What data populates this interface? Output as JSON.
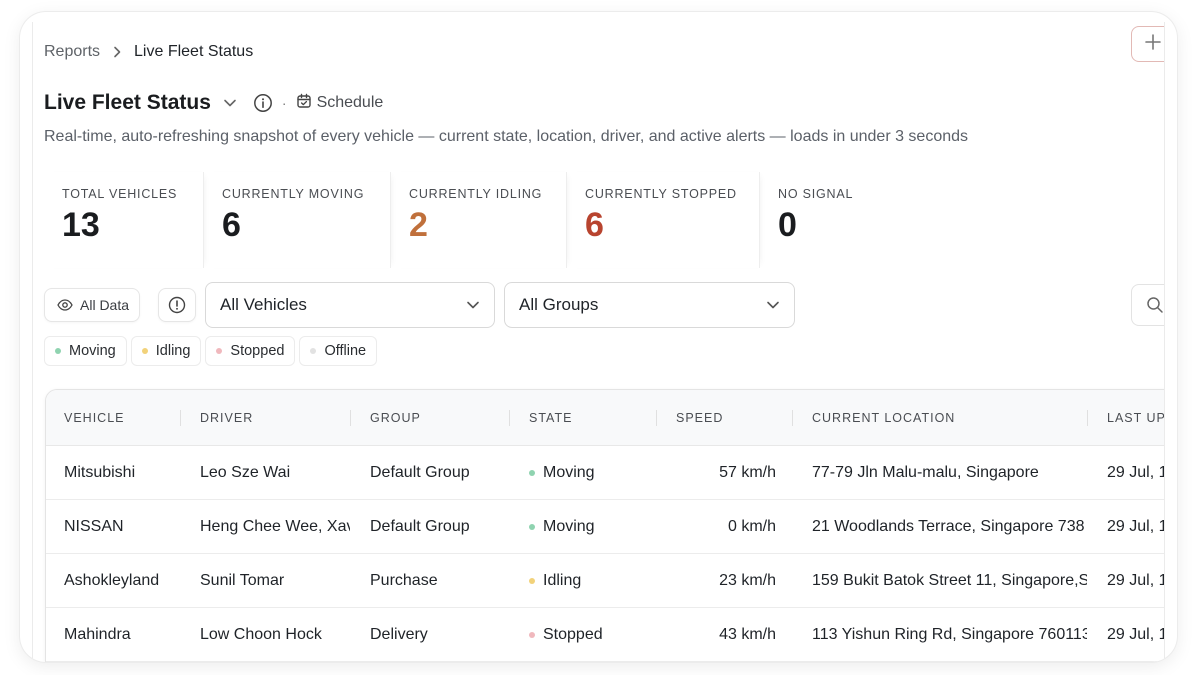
{
  "breadcrumb": {
    "parent": "Reports",
    "current": "Live Fleet Status"
  },
  "header": {
    "title": "Live Fleet Status",
    "schedule_label": "Schedule",
    "subtitle": "Real-time, auto-refreshing snapshot of every vehicle — current state, location, driver, and active alerts — loads in under 3 seconds"
  },
  "stats": [
    {
      "label": "TOTAL VEHICLES",
      "value": "13",
      "color": "#1a1c1f"
    },
    {
      "label": "CURRENTLY MOVING",
      "value": "6",
      "color": "#1a1c1f"
    },
    {
      "label": "CURRENTLY IDLING",
      "value": "2",
      "color": "#c0703b"
    },
    {
      "label": "CURRENTLY STOPPED",
      "value": "6",
      "color": "#b8442f"
    },
    {
      "label": "NO SIGNAL",
      "value": "0",
      "color": "#1a1c1f"
    }
  ],
  "filters": {
    "all_data_label": "All Data",
    "vehicles_select": "All Vehicles",
    "groups_select": "All Groups"
  },
  "legend": [
    {
      "label": "Moving",
      "color": "#8fd3b0"
    },
    {
      "label": "Idling",
      "color": "#f2d27a"
    },
    {
      "label": "Stopped",
      "color": "#f0b8bd"
    },
    {
      "label": "Offline",
      "color": "#e2e2e2"
    }
  ],
  "table": {
    "columns": [
      "VEHICLE",
      "DRIVER",
      "GROUP",
      "STATE",
      "SPEED",
      "CURRENT LOCATION",
      "LAST UP"
    ],
    "rows": [
      {
        "vehicle": "Mitsubishi",
        "driver": "Leo Sze Wai",
        "group": "Default Group",
        "state": "Moving",
        "state_color": "#8fd3b0",
        "speed": "57 km/h",
        "location": "77-79 Jln Malu-malu, Singapore",
        "last_update": "29 Jul, 1"
      },
      {
        "vehicle": "NISSAN",
        "driver": "Heng Chee Wee, Xav",
        "group": "Default Group",
        "state": "Moving",
        "state_color": "#8fd3b0",
        "speed": "0 km/h",
        "location": "21 Woodlands Terrace, Singapore 738",
        "last_update": "29 Jul, 1"
      },
      {
        "vehicle": "Ashokleyland",
        "driver": "Sunil Tomar",
        "group": "Purchase",
        "state": "Idling",
        "state_color": "#f2d27a",
        "speed": "23 km/h",
        "location": "159 Bukit Batok Street 11, Singapore,S",
        "last_update": "29 Jul, 1"
      },
      {
        "vehicle": "Mahindra",
        "driver": "Low Choon Hock",
        "group": "Delivery",
        "state": "Stopped",
        "state_color": "#f0b8bd",
        "speed": "43 km/h",
        "location": "113 Yishun Ring Rd, Singapore 760113",
        "last_update": "29 Jul, 1"
      }
    ]
  }
}
